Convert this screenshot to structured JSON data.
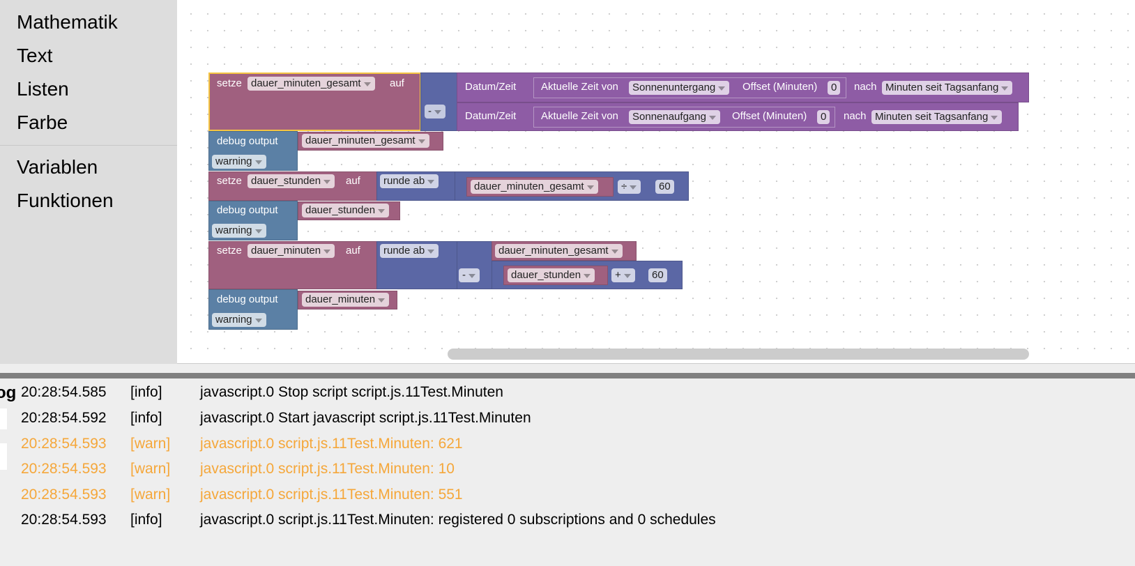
{
  "sidebar": {
    "categories": [
      "Mathematik",
      "Text",
      "Listen",
      "Farbe",
      "Variablen",
      "Funktionen"
    ]
  },
  "blocks": {
    "set": "setze",
    "to": "auf",
    "minus": "-",
    "plus": "+",
    "div": "÷",
    "round": "runde ab",
    "datetime": "Datum/Zeit",
    "current_time": "Aktuelle Zeit von",
    "offset": "Offset (Minuten)",
    "after": "nach",
    "sunset": "Sonnenuntergang",
    "sunrise": "Sonnenaufgang",
    "offset_value": "0",
    "minutes_since": "Minuten seit Tagsanfang",
    "debug": "debug output",
    "warning": "warning",
    "sixty": "60",
    "var_total": "dauer_minuten_gesamt",
    "var_hours": "dauer_stunden",
    "var_minutes": "dauer_minuten"
  },
  "log": {
    "label": "og",
    "entries": [
      {
        "time": "20:28:54.585",
        "level": "[info]",
        "msg": "javascript.0 Stop script script.js.11Test.Minuten"
      },
      {
        "time": "20:28:54.592",
        "level": "[info]",
        "msg": "javascript.0 Start javascript script.js.11Test.Minuten"
      },
      {
        "time": "20:28:54.593",
        "level": "[warn]",
        "msg": "javascript.0 script.js.11Test.Minuten: 621"
      },
      {
        "time": "20:28:54.593",
        "level": "[warn]",
        "msg": "javascript.0 script.js.11Test.Minuten: 10"
      },
      {
        "time": "20:28:54.593",
        "level": "[warn]",
        "msg": "javascript.0 script.js.11Test.Minuten: 551"
      },
      {
        "time": "20:28:54.593",
        "level": "[info]",
        "msg": "javascript.0 script.js.11Test.Minuten: registered 0 subscriptions and 0 schedules"
      }
    ]
  },
  "colors": {
    "variables": "#a0607f",
    "math": "#5b67a5",
    "time": "#8e5ca5",
    "debug": "#5b80a5",
    "warn": "#f5a73a",
    "selected": "#f5c542"
  }
}
